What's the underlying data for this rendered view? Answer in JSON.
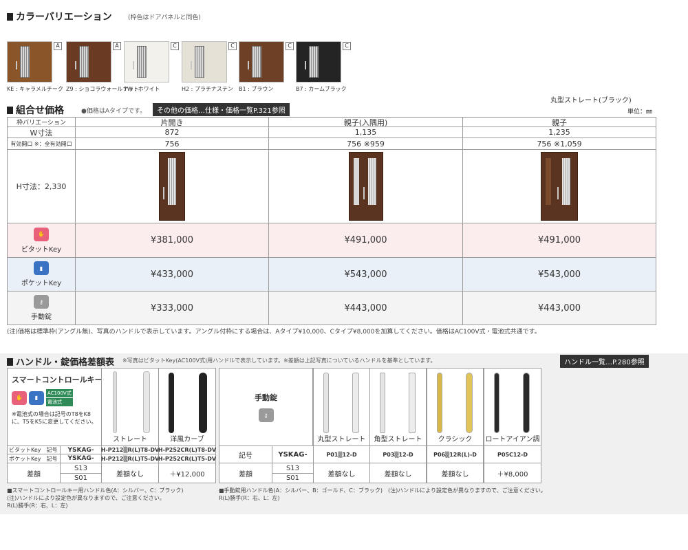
{
  "color": {
    "title": "カラーバリエーション",
    "subtitle": "(枠色はドアパネルと同色)",
    "swatches": [
      {
        "code": "KE : キャラメルチーク",
        "grade": "A",
        "color": "#8a5528"
      },
      {
        "code": "Z9 : ショコラウォールナット",
        "grade": "A",
        "color": "#6a3a22"
      },
      {
        "code": "YW : ホワイト",
        "grade": "C",
        "color": "#f2f1ec"
      },
      {
        "code": "H2 : プラチナステン",
        "grade": "C",
        "color": "#e6e1d6"
      },
      {
        "code": "B1 : ブラウン",
        "grade": "C",
        "color": "#6e4126"
      },
      {
        "code": "B7 : カームブラック",
        "grade": "C",
        "color": "#242424"
      }
    ]
  },
  "combo": {
    "title": "組合せ価格",
    "note": "●価格はAタイプです。",
    "ref": "その他の価格…仕様・価格一覧P.321参照",
    "handle_note": "丸型ストレート(ブラック)",
    "unit": "単位：㎜",
    "header": [
      "枠バリエーション",
      "片開き",
      "親子(入隅用)",
      "親子"
    ],
    "w_label": "W寸法",
    "w_values": [
      "872",
      "1,135",
      "1,235"
    ],
    "open_label": "有効開口 ※：全有効開口",
    "open_values": [
      "756",
      "756 ※959",
      "756 ※1,059"
    ],
    "h_label": "H寸法：2,330",
    "rows": [
      {
        "key": "ビタットKey",
        "prices": [
          "¥381,000",
          "¥491,000",
          "¥491,000"
        ],
        "color": "#fbecee",
        "icon": "#e8607a"
      },
      {
        "key": "ポケットKey",
        "prices": [
          "¥433,000",
          "¥543,000",
          "¥543,000"
        ],
        "color": "#eaf0f8",
        "icon": "#3a72c4"
      },
      {
        "key": "手動錠",
        "prices": [
          "¥333,000",
          "¥443,000",
          "¥443,000"
        ],
        "color": "#f4f4f4",
        "icon": "#9a9a9a"
      }
    ],
    "footnote": "(注)価格は標準枠(アングル無)、写真のハンドルで表示しています。アングル付枠にする場合は、Aタイプ¥10,000、Cタイプ¥8,000を加算してください。価格はAC100V式・電池式共通です。"
  },
  "handle": {
    "title": "ハンドル・錠価格差額表",
    "subtitle": "※写真はビタットKey(AC100V式)用ハンドルで表示しています。※差額は上記写真についているハンドルを基準としています。",
    "ref": "ハンドル一覧…P.280参照",
    "smart": {
      "title": "スマートコントロールキー",
      "tag1": "AC100V式",
      "tag2": "電池式",
      "note": "※電池式の場合は記号のT8をK8に、T5をK5に変更してください。",
      "col_names": [
        "ストレート",
        "洋風カーブ"
      ],
      "row1": [
        "ビタットKey　記号",
        "YSKAG-",
        "H-P212▒R(L)T8-DV",
        "H-P252CR(L)T8-DV"
      ],
      "row2": [
        "ポケットKey　記号",
        "YSKAG-",
        "H-P212▒R(L)T5-DV",
        "H-P252CR(L)T5-DV"
      ],
      "diff_label": "差額",
      "s13": "S13",
      "s01": "S01",
      "diffs": [
        "差額なし",
        "＋¥12,000"
      ],
      "note_bottom1": "■スマートコントロールキー用ハンドル色(A：シルバー、C：ブラック)",
      "note_bottom2": "(注)ハンドルにより設定色が異なりますので、ご注意ください。",
      "note_bottom3": "R(L)勝手(R：右、L：左)"
    },
    "manual": {
      "title": "手動錠",
      "col_names": [
        "丸型ストレート",
        "角型ストレート",
        "クラシック",
        "ロートアイアン調"
      ],
      "code_label": "記号",
      "code_prefix": "YSKAG-",
      "codes": [
        "P01▒12-D",
        "P03▒12-D",
        "P06▒12R(L)-D",
        "P05C12-D"
      ],
      "diff_label": "差額",
      "s13": "S13",
      "s01": "S01",
      "diffs": [
        "差額なし",
        "差額なし",
        "差額なし",
        "＋¥8,000"
      ],
      "note_bottom1": "■手動錠用ハンドル色(A：シルバー、B：ゴールド、C：ブラック)　(注)ハンドルにより設定色が異なりますので、ご注意ください。",
      "note_bottom2": "R(L)勝手(R：右、L：左)"
    }
  }
}
